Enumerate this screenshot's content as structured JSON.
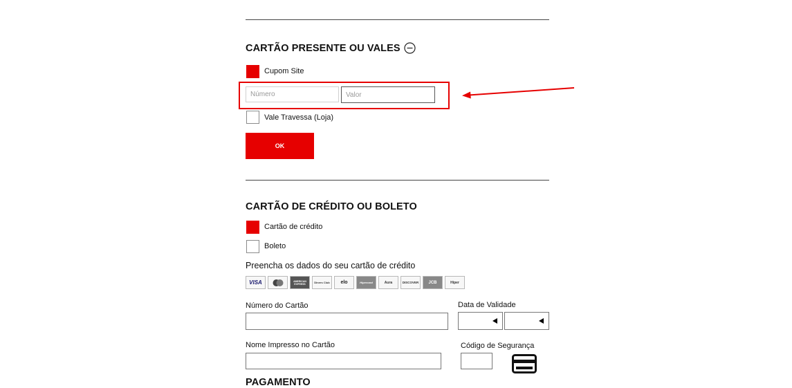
{
  "gift_section": {
    "title": "CARTÃO PRESENTE OU VALES",
    "collapse_icon": "minus-circle-icon",
    "options": [
      {
        "label": "Cupom Site",
        "checked": true
      },
      {
        "label": "Vale Travessa (Loja)",
        "checked": false
      }
    ],
    "numero_placeholder": "Número",
    "valor_placeholder": "Valor",
    "ok_label": "OK"
  },
  "payment_section": {
    "title": "CARTÃO DE CRÉDITO OU BOLETO",
    "options": [
      {
        "label": "Cartão de crédito",
        "checked": true
      },
      {
        "label": "Boleto",
        "checked": false
      }
    ],
    "instructions": "Preencha os dados do seu cartão de crédito",
    "card_brands": [
      "VISA",
      "",
      "AMERICAN EXPRESS",
      "Diners Club",
      "elo",
      "Hipercard",
      "Aura",
      "DISCOVER",
      "JCB",
      "Hiper"
    ],
    "card_number_label": "Número do Cartão",
    "validity_label": "Data de Validade",
    "name_label": "Nome Impresso no Cartão",
    "security_label": "Código de Segurança",
    "security_icon": "credit-card-icon",
    "next_section_title": "PAGAMENTO"
  },
  "annotation": {
    "highlight_color": "#e60000"
  },
  "colors": {
    "accent": "#e60000"
  }
}
